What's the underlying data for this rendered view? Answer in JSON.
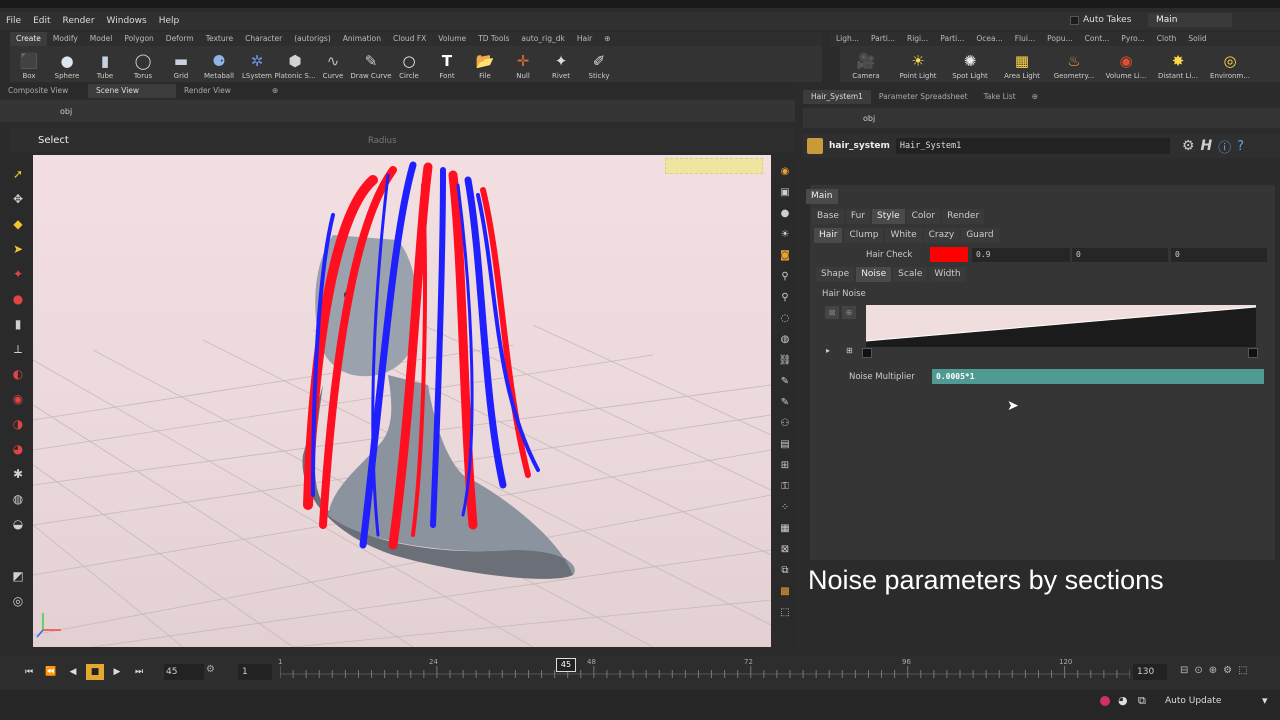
{
  "menu": [
    "File",
    "Edit",
    "Render",
    "Windows",
    "Help"
  ],
  "auto_takes": "Auto Takes",
  "main_tag": "Main",
  "shelf_tabs": [
    "Create",
    "Modify",
    "Model",
    "Polygon",
    "Deform",
    "Texture",
    "Character",
    "(autorigs)",
    "Animation",
    "Cloud FX",
    "Volume",
    "TD Tools",
    "auto_rig_dk",
    "Hair"
  ],
  "tools": [
    {
      "label": "Box",
      "icon": "box-icon",
      "glyph": "⬛"
    },
    {
      "label": "Sphere",
      "icon": "sphere-icon",
      "glyph": "●"
    },
    {
      "label": "Tube",
      "icon": "tube-icon",
      "glyph": "▮"
    },
    {
      "label": "Torus",
      "icon": "torus-icon",
      "glyph": "◯"
    },
    {
      "label": "Grid",
      "icon": "grid-icon",
      "glyph": "▬"
    },
    {
      "label": "Metaball",
      "icon": "metaball-icon",
      "glyph": "⚈"
    },
    {
      "label": "LSystem",
      "icon": "lsystem-icon",
      "glyph": "✲"
    },
    {
      "label": "Platonic S...",
      "icon": "platonic-icon",
      "glyph": "⬢"
    },
    {
      "label": "Curve",
      "icon": "curve-icon",
      "glyph": "∿"
    },
    {
      "label": "Draw Curve",
      "icon": "draw-curve-icon",
      "glyph": "✎"
    },
    {
      "label": "Circle",
      "icon": "circle-icon",
      "glyph": "○"
    },
    {
      "label": "Font",
      "icon": "font-icon",
      "glyph": "T"
    },
    {
      "label": "File",
      "icon": "file-icon",
      "glyph": "📂"
    },
    {
      "label": "Null",
      "icon": "null-icon",
      "glyph": "✛"
    },
    {
      "label": "Rivet",
      "icon": "rivet-icon",
      "glyph": "✦"
    },
    {
      "label": "Sticky",
      "icon": "sticky-icon",
      "glyph": "✐"
    }
  ],
  "light_tabs": [
    "Ligh...",
    "Parti...",
    "Rigi...",
    "Parti...",
    "Ocea...",
    "Flui...",
    "Popu...",
    "Cont...",
    "Pyro...",
    "Cloth",
    "Solid"
  ],
  "light_tools": [
    {
      "label": "Camera",
      "icon": "camera-icon",
      "glyph": "🎥"
    },
    {
      "label": "Point Light",
      "icon": "point-light-icon",
      "glyph": "☀"
    },
    {
      "label": "Spot Light",
      "icon": "spot-light-icon",
      "glyph": "✺"
    },
    {
      "label": "Area Light",
      "icon": "area-light-icon",
      "glyph": "▦"
    },
    {
      "label": "Geometry...",
      "icon": "geometry-light-icon",
      "glyph": "♨"
    },
    {
      "label": "Volume Li...",
      "icon": "volume-light-icon",
      "glyph": "◉"
    },
    {
      "label": "Distant Li...",
      "icon": "distant-light-icon",
      "glyph": "✸"
    },
    {
      "label": "Environm...",
      "icon": "environment-light-icon",
      "glyph": "◎"
    }
  ],
  "viewport_tabs": [
    "Composite View",
    "Scene View",
    "Render View"
  ],
  "viewport_path": "obj",
  "select_label": "Select",
  "radius_label": "Radius",
  "param_tabs": [
    "Hair_System1",
    "Parameter Spreadsheet",
    "Take List"
  ],
  "param_path": "obj",
  "node": {
    "type": "hair_system",
    "name": "Hair_System1"
  },
  "main_tab": "Main",
  "group_tabs": [
    "Base",
    "Fur",
    "Style",
    "Color",
    "Render"
  ],
  "style_tabs": [
    "Hair",
    "Clump",
    "White",
    "Crazy",
    "Guard"
  ],
  "hair_check": {
    "label": "Hair Check",
    "color": "#ff0000",
    "v1": "0.9",
    "v2": "0",
    "v3": "0"
  },
  "hair_subtabs": [
    "Shape",
    "Noise",
    "Scale",
    "Width"
  ],
  "hair_noise_label": "Hair Noise",
  "noise_multiplier": {
    "label": "Noise Multiplier",
    "value": "0.0005*1"
  },
  "caption": "Noise parameters by sections",
  "timeline": {
    "current_frame": "45",
    "start_frame": "1",
    "end_frame": "130",
    "ticks": [
      "1",
      "24",
      "48",
      "72",
      "96",
      "120"
    ],
    "marker": "45"
  },
  "auto_update": "Auto Update"
}
